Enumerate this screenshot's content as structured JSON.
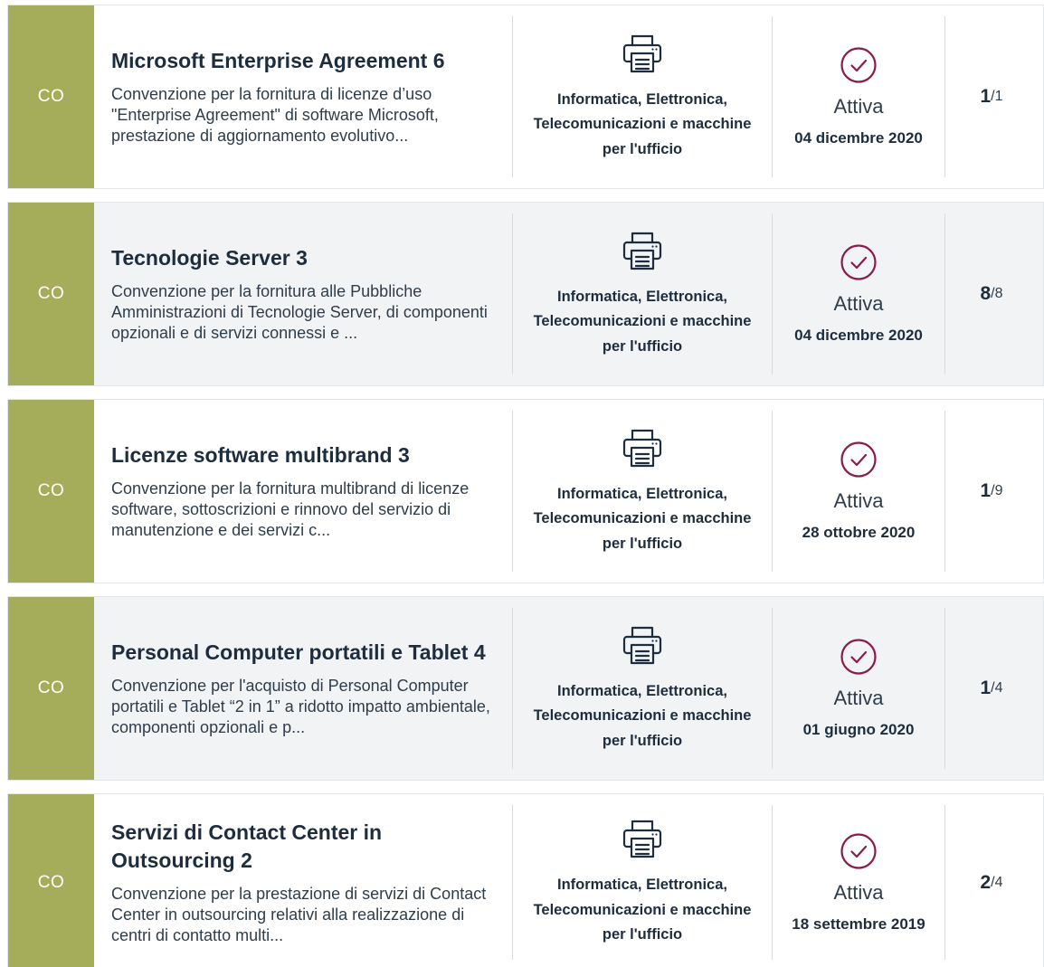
{
  "colors": {
    "tag_bg": "#a6ad5a",
    "status_icon": "#8a1c4a",
    "alt_row_bg": "#f1f3f5"
  },
  "icons": {
    "category": "printer-icon",
    "status": "check-circle-icon"
  },
  "items": [
    {
      "tag": "CO",
      "title": "Microsoft Enterprise Agreement 6",
      "description": "Convenzione per la fornitura di licenze d’uso \"Enterprise Agreement\" di software Microsoft, prestazione di aggiornamento evolutivo...",
      "category_line1": "Informatica, Elettronica,",
      "category_line2": "Telecomunicazioni e macchine",
      "category_line3": "per l'ufficio",
      "status": "Attiva",
      "date": "04 dicembre 2020",
      "count": "1",
      "total": "/1"
    },
    {
      "tag": "CO",
      "title": "Tecnologie Server 3",
      "description": "Convenzione per la fornitura alle Pubbliche Amministrazioni di Tecnologie Server, di componenti opzionali e di servizi connessi e ...",
      "category_line1": "Informatica, Elettronica,",
      "category_line2": "Telecomunicazioni e macchine",
      "category_line3": "per l'ufficio",
      "status": "Attiva",
      "date": "04 dicembre 2020",
      "count": "8",
      "total": "/8"
    },
    {
      "tag": "CO",
      "title": "Licenze software multibrand 3",
      "description": "Convenzione per la fornitura multibrand di licenze software, sottoscrizioni e rinnovo del servizio di manutenzione e dei servizi c...",
      "category_line1": "Informatica, Elettronica,",
      "category_line2": "Telecomunicazioni e macchine",
      "category_line3": "per l'ufficio",
      "status": "Attiva",
      "date": "28 ottobre 2020",
      "count": "1",
      "total": "/9"
    },
    {
      "tag": "CO",
      "title": "Personal Computer portatili e Tablet 4",
      "description": "Convenzione per l'acquisto di Personal Computer portatili e Tablet “2 in 1” a ridotto impatto ambientale, componenti opzionali e p...",
      "category_line1": "Informatica, Elettronica,",
      "category_line2": "Telecomunicazioni e macchine",
      "category_line3": "per l'ufficio",
      "status": "Attiva",
      "date": "01 giugno 2020",
      "count": "1",
      "total": "/4"
    },
    {
      "tag": "CO",
      "title": "Servizi di Contact Center in Outsourcing 2",
      "description": "Convenzione per la prestazione di servizi di Contact Center in outsourcing relativi alla realizzazione di centri di contatto multi...",
      "category_line1": "Informatica, Elettronica,",
      "category_line2": "Telecomunicazioni e macchine",
      "category_line3": "per l'ufficio",
      "status": "Attiva",
      "date": "18 settembre 2019",
      "count": "2",
      "total": "/4"
    }
  ]
}
